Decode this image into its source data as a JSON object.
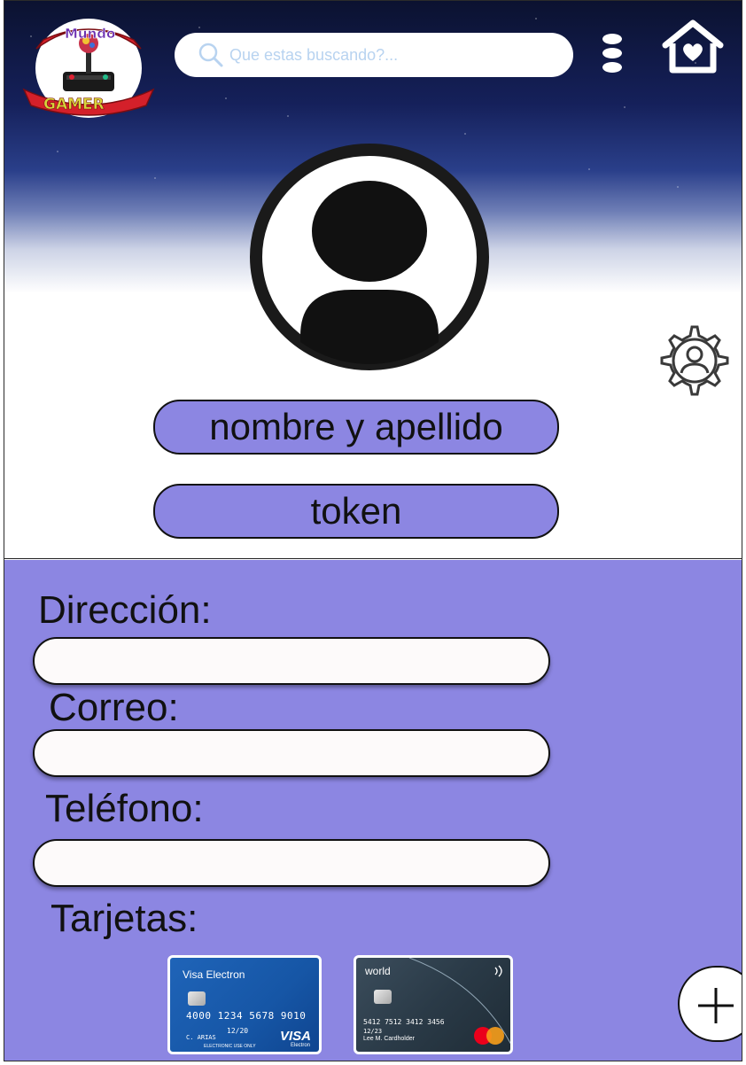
{
  "header": {
    "logo_text": "Mundo GAMER",
    "search_placeholder": "Que estas buscando?..."
  },
  "profile": {
    "name_label": "nombre y apellido",
    "token_label": "token"
  },
  "form": {
    "address_label": "Dirección:",
    "email_label": "Correo:",
    "phone_label": "Teléfono:",
    "cards_label": "Tarjetas:"
  },
  "cards": {
    "visa": {
      "brand": "Visa Electron",
      "number": "4000 1234 5678 9010",
      "holder": "C. ARIAS",
      "expiry": "12/20",
      "logo": "VISA",
      "sub": "Electron",
      "footer": "ELECTRONIC USE ONLY"
    },
    "mastercard": {
      "brand": "world",
      "number": "5412 7512 3412 3456",
      "expiry": "12/23",
      "holder": "Lee M. Cardholder"
    }
  },
  "colors": {
    "accent": "#8c86e2",
    "field": "#fdfafa"
  }
}
